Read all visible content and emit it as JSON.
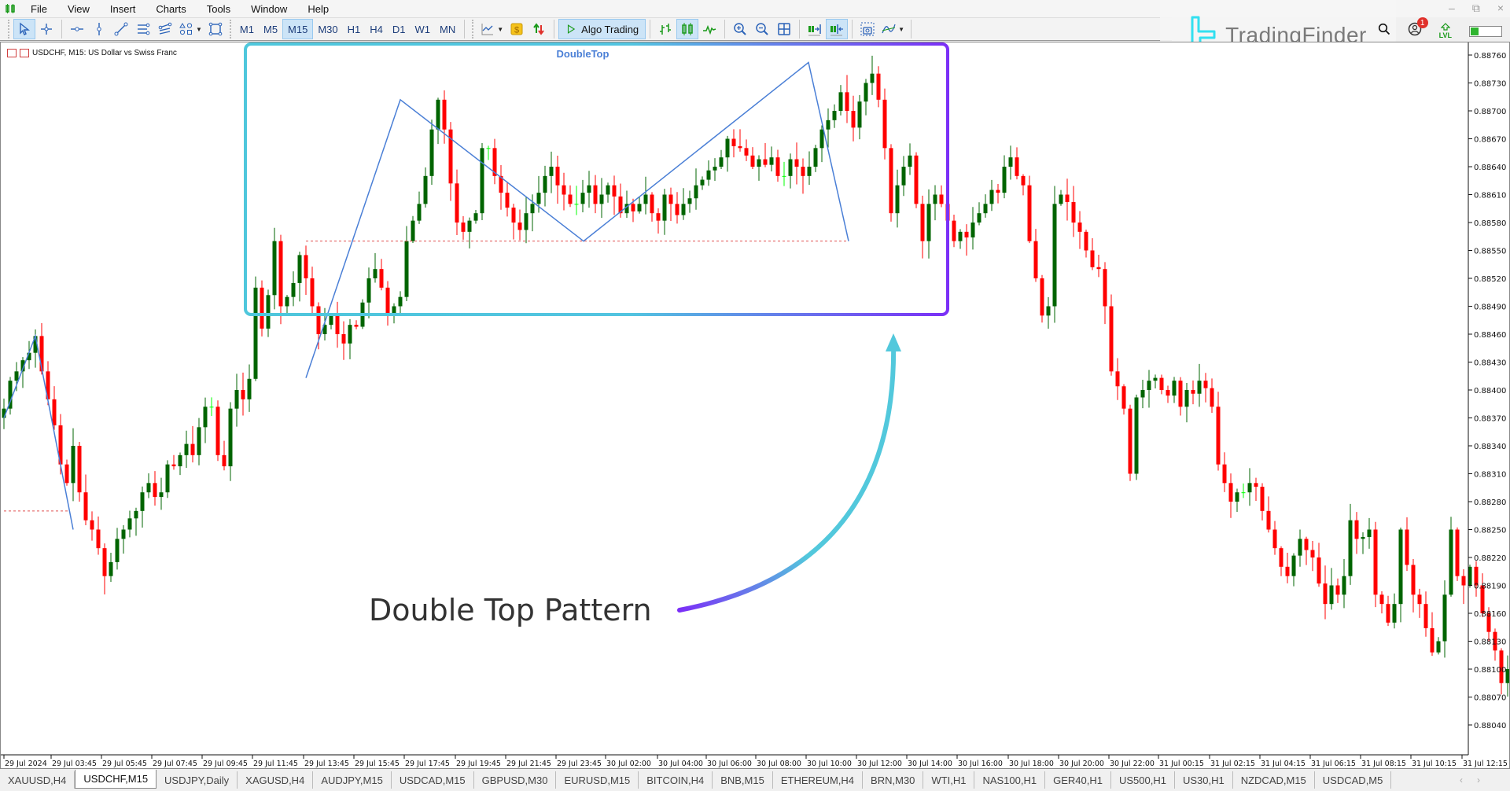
{
  "app": {
    "menu": [
      "File",
      "View",
      "Insert",
      "Charts",
      "Tools",
      "Window",
      "Help"
    ],
    "window_controls": [
      "minimize",
      "restore",
      "close"
    ]
  },
  "toolbar": {
    "drawing_tools": [
      {
        "icon": "cursor-icon",
        "active": true
      },
      {
        "icon": "crosshair-icon",
        "active": false
      },
      {
        "icon": "horizontal-line-icon",
        "active": false
      },
      {
        "icon": "vertical-line-icon",
        "active": false
      },
      {
        "icon": "trendline-icon",
        "active": false
      },
      {
        "icon": "channel-icon",
        "active": false
      },
      {
        "icon": "fibonacci-icon",
        "active": false
      },
      {
        "icon": "shapes-icon",
        "active": false
      },
      {
        "icon": "rectangle-icon",
        "active": false
      }
    ],
    "timeframes": [
      "M1",
      "M5",
      "M15",
      "M30",
      "H1",
      "H4",
      "D1",
      "W1",
      "MN"
    ],
    "active_timeframe": "M15",
    "algo_trading_label": "Algo Trading"
  },
  "brand": {
    "name": "TradingFinder"
  },
  "right_tools": {
    "notification_count": "1",
    "lvl_label": "LVL",
    "signal_level": 0.25
  },
  "chart": {
    "title": "USDCHF, M15:  US Dollar vs Swiss Franc",
    "pattern_label": "DoubleTop",
    "annotation": "Double Top Pattern",
    "colors": {
      "bull": "#006400",
      "bear": "#ff0000",
      "doji": "#00ff00",
      "zigzag": "#4a7fd6",
      "neckline": "#e05050",
      "box_start": "#4fc7dc",
      "box_end": "#7b2ff7",
      "axis_text": "#111111"
    }
  },
  "chart_data": {
    "type": "candlestick",
    "symbol": "USDCHF",
    "timeframe": "M15",
    "y_ticks": [
      "0.88760",
      "0.88730",
      "0.88700",
      "0.88670",
      "0.88640",
      "0.88610",
      "0.88580",
      "0.88550",
      "0.88520",
      "0.88490",
      "0.88460",
      "0.88430",
      "0.88400",
      "0.88370",
      "0.88340",
      "0.88310",
      "0.88280",
      "0.88250",
      "0.88220",
      "0.88190",
      "0.88160",
      "0.88130",
      "0.88100",
      "0.88070",
      "0.88040"
    ],
    "ylim": [
      0.8801,
      0.8878
    ],
    "x_ticks": [
      "29 Jul 2024",
      "29 Jul 03:45",
      "29 Jul 05:45",
      "29 Jul 07:45",
      "29 Jul 09:45",
      "29 Jul 11:45",
      "29 Jul 13:45",
      "29 Jul 15:45",
      "29 Jul 17:45",
      "29 Jul 19:45",
      "29 Jul 21:45",
      "29 Jul 23:45",
      "30 Jul 02:00",
      "30 Jul 04:00",
      "30 Jul 06:00",
      "30 Jul 08:00",
      "30 Jul 10:00",
      "30 Jul 12:00",
      "30 Jul 14:00",
      "30 Jul 16:00",
      "30 Jul 18:00",
      "30 Jul 20:00",
      "30 Jul 22:00",
      "31 Jul 00:15",
      "31 Jul 02:15",
      "31 Jul 04:15",
      "31 Jul 06:15",
      "31 Jul 08:15",
      "31 Jul 10:15",
      "31 Jul 12:15"
    ],
    "double_top": {
      "start": 0.88413,
      "peak1": 0.88712,
      "neckline": 0.8856,
      "peak2": 0.88752,
      "end": 0.8856
    },
    "candles_close": [
      0.8838,
      0.8841,
      0.8842,
      0.88432,
      0.8844,
      0.88458,
      0.8842,
      0.8839,
      0.88362,
      0.8832,
      0.883,
      0.8834,
      0.8829,
      0.8826,
      0.8825,
      0.8823,
      0.882,
      0.88215,
      0.8824,
      0.8825,
      0.88262,
      0.8827,
      0.8829,
      0.883,
      0.88285,
      0.8829,
      0.8832,
      0.88318,
      0.8833,
      0.88342,
      0.8833,
      0.8836,
      0.88382,
      0.88382,
      0.8833,
      0.88318,
      0.8838,
      0.884,
      0.8839,
      0.88412,
      0.8851,
      0.88466,
      0.88502,
      0.8856,
      0.8849,
      0.885,
      0.88515,
      0.88545,
      0.8852,
      0.8849,
      0.8846,
      0.8847,
      0.8848,
      0.8846,
      0.8845,
      0.8847,
      0.88468,
      0.88494,
      0.8852,
      0.8853,
      0.8851,
      0.8848,
      0.8849,
      0.885,
      0.8856,
      0.88582,
      0.886,
      0.8863,
      0.8868,
      0.88712,
      0.8868,
      0.88622,
      0.8858,
      0.8857,
      0.88582,
      0.8859,
      0.8866,
      0.8866,
      0.8863,
      0.88612,
      0.88596,
      0.8858,
      0.88572,
      0.8859,
      0.886,
      0.88612,
      0.8863,
      0.8864,
      0.8862,
      0.8861,
      0.886,
      0.886,
      0.88612,
      0.8862,
      0.886,
      0.8861,
      0.8862,
      0.88608,
      0.8859,
      0.886,
      0.88592,
      0.886,
      0.8861,
      0.8859,
      0.88582,
      0.8861,
      0.886,
      0.88588,
      0.886,
      0.88606,
      0.8862,
      0.88626,
      0.88636,
      0.8864,
      0.8865,
      0.8867,
      0.88662,
      0.8866,
      0.88652,
      0.8864,
      0.88648,
      0.88642,
      0.8865,
      0.8863,
      0.8863,
      0.88648,
      0.8864,
      0.8863,
      0.8864,
      0.8866,
      0.8868,
      0.8869,
      0.887,
      0.8872,
      0.887,
      0.88682,
      0.8871,
      0.8873,
      0.8874,
      0.88712,
      0.8866,
      0.8859,
      0.8862,
      0.8864,
      0.88652,
      0.886,
      0.8856,
      0.886,
      0.8861,
      0.886,
      0.88582,
      0.8856,
      0.8857,
      0.88564,
      0.8858,
      0.8859,
      0.886,
      0.88615,
      0.88612,
      0.8864,
      0.8865,
      0.8863,
      0.8862,
      0.8856,
      0.8852,
      0.8848,
      0.8849,
      0.886,
      0.8861,
      0.88602,
      0.8858,
      0.8857,
      0.8855,
      0.88532,
      0.8853,
      0.8849,
      0.8842,
      0.88404,
      0.8838,
      0.8831,
      0.88392,
      0.884,
      0.8841,
      0.88413,
      0.884,
      0.88394,
      0.8841,
      0.88382,
      0.884,
      0.88396,
      0.8841,
      0.88402,
      0.88382,
      0.8832,
      0.883,
      0.8828,
      0.8829,
      0.8829,
      0.883,
      0.88296,
      0.8827,
      0.8825,
      0.8823,
      0.8821,
      0.882,
      0.88222,
      0.8824,
      0.88228,
      0.8822,
      0.88192,
      0.8817,
      0.8819,
      0.8818,
      0.882,
      0.8826,
      0.8824,
      0.88242,
      0.8825,
      0.8818,
      0.8817,
      0.8815,
      0.8817,
      0.8825,
      0.88212,
      0.8818,
      0.8817,
      0.88144,
      0.88118,
      0.8813,
      0.8818,
      0.8825,
      0.882,
      0.8819,
      0.8821,
      0.8819,
      0.8816,
      0.8814,
      0.8812,
      0.88085,
      0.881,
      0.8815,
      0.8818,
      0.8816,
      0.88118,
      0.88116,
      0.8816
    ]
  },
  "tabs": [
    {
      "label": "XAUUSD,H4",
      "active": false
    },
    {
      "label": "USDCHF,M15",
      "active": true
    },
    {
      "label": "USDJPY,Daily",
      "active": false
    },
    {
      "label": "XAGUSD,H4",
      "active": false
    },
    {
      "label": "AUDJPY,M15",
      "active": false
    },
    {
      "label": "USDCAD,M15",
      "active": false
    },
    {
      "label": "GBPUSD,M30",
      "active": false
    },
    {
      "label": "EURUSD,M15",
      "active": false
    },
    {
      "label": "BITCOIN,H4",
      "active": false
    },
    {
      "label": "BNB,M15",
      "active": false
    },
    {
      "label": "ETHEREUM,H4",
      "active": false
    },
    {
      "label": "BRN,M30",
      "active": false
    },
    {
      "label": "WTI,H1",
      "active": false
    },
    {
      "label": "NAS100,H1",
      "active": false
    },
    {
      "label": "GER40,H1",
      "active": false
    },
    {
      "label": "US500,H1",
      "active": false
    },
    {
      "label": "US30,H1",
      "active": false
    },
    {
      "label": "NZDCAD,M15",
      "active": false
    },
    {
      "label": "USDCAD,M5",
      "active": false
    }
  ]
}
